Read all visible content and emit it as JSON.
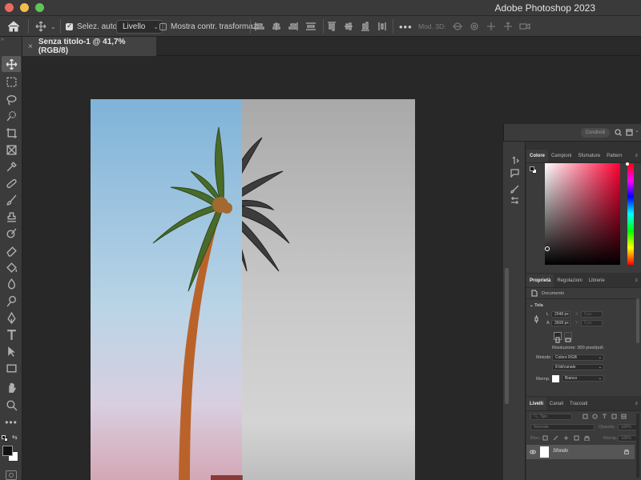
{
  "app": {
    "title": "Adobe Photoshop 2023"
  },
  "window_controls": {
    "close_color": "#ed6a5e",
    "minimize_color": "#f5bf4f",
    "zoom_color": "#61c554"
  },
  "options_bar": {
    "auto_select_label": "Selez. auto:",
    "auto_select_checked": true,
    "auto_select_target": "Livello",
    "show_transform_label": "Mostra contr. trasformaz.",
    "show_transform_checked": false,
    "mode_3d_label": "Mod. 3D:"
  },
  "document_tab": {
    "close_glyph": "×",
    "title": "Senza titolo-1 @ 41,7% (RGB/8)"
  },
  "workspace_label": "Condividi",
  "color_panel": {
    "tabs": [
      "Colore",
      "Campioni",
      "Sfumature",
      "Pattern"
    ],
    "active_tab": "Colore"
  },
  "properties_panel": {
    "tabs": [
      "Proprietà",
      "Regolazioni",
      "Librerie"
    ],
    "active_tab": "Proprietà",
    "document_label": "Documento",
    "canvas_section": "Tela",
    "width_prefix": "L",
    "width": "2048 px",
    "height_prefix": "A",
    "height": "3508 px",
    "x_prefix": "X",
    "x_value": "0 px",
    "y_prefix": "Y",
    "y_value": "0 px",
    "resolution": "Risoluzione: 300 pixel/poll.",
    "mode_label": "Metodo",
    "mode_value": "Colore RGB",
    "bits_value": "8 bit/canale",
    "fill_label": "Riemp.",
    "fill_value": "Bianco"
  },
  "layers_panel": {
    "tabs": [
      "Livelli",
      "Canali",
      "Tracciati"
    ],
    "active_tab": "Livelli",
    "filter_kind": "Tipo",
    "blend_mode": "Normale",
    "opacity_label": "Opacità:",
    "opacity_value": "100%",
    "lock_label": "Bloc.:",
    "fill_label": "Riemp.:",
    "fill_value": "100%",
    "layers": [
      {
        "name": "Sfondo",
        "visible": true,
        "locked": true
      }
    ]
  },
  "colors": {
    "accent_active": "#5a5a5a",
    "panel_bg": "#3b3b3b",
    "canvas_bg": "#282828"
  }
}
